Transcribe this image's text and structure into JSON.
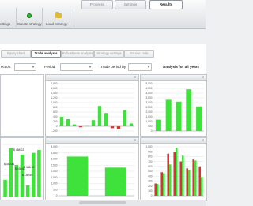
{
  "toolbar": {
    "settings_label": "ettings",
    "create_label": "Create strategy",
    "load_label": "Load strategy"
  },
  "main_tabs": [
    "Progress",
    "Settings",
    "Results"
  ],
  "sub_tabs": [
    "Equity chart",
    "Trade analysis",
    "Robustness analysis",
    "Strategy settings",
    "Source code"
  ],
  "filters": {
    "direction_label": "ection:",
    "period_label": "Period:",
    "trade_period_label": "Trade period by:",
    "analysis_label": "Analysis for all years"
  },
  "colors": {
    "green": "#3ee23a",
    "red": "#e0312d",
    "accent_button": "#2fb533"
  },
  "chart_data": [
    {
      "type": "bar",
      "position": "top-middle",
      "y_ticks": [
        "1,800",
        "1,600",
        "1,400",
        "1,200",
        "1,000",
        "800",
        "600",
        "400",
        "200",
        "0",
        "-200"
      ],
      "values": [
        400,
        300,
        80,
        -40,
        10,
        260,
        860,
        560,
        -80,
        -120,
        680,
        120
      ],
      "ylim": [
        -200,
        1800
      ]
    },
    {
      "type": "bar",
      "position": "top-right",
      "y_ticks": [
        "5,000",
        "4,500",
        "4,000",
        "3,500",
        "3,000",
        "2,500",
        "2,000",
        "1,500",
        "1,000",
        "500",
        "0"
      ],
      "values": [
        1200,
        3300,
        3100,
        4400,
        2600
      ],
      "ylim": [
        0,
        5000
      ]
    },
    {
      "type": "bar",
      "position": "bottom-left",
      "value_labels": [
        "$ 488.02",
        "$ 350.41",
        "$ 458.63",
        "$ 488.10",
        "$ 140.90"
      ],
      "series": [
        {
          "name": "",
          "values": [
            180,
            520,
            340,
            450,
            120,
            470,
            500
          ]
        }
      ]
    },
    {
      "type": "bar",
      "position": "bottom-middle",
      "y_ticks": [
        "4,000",
        "3,500",
        "3,000",
        "2,500",
        "2,000",
        "1,500",
        "1,000",
        "500",
        "0"
      ],
      "values": [
        3200,
        2300
      ],
      "ylim": [
        0,
        4000
      ]
    },
    {
      "type": "bar",
      "position": "bottom-right",
      "y_ticks": [
        "1,000",
        "900",
        "800",
        "700",
        "600",
        "500",
        "400",
        "300",
        "200",
        "100",
        "0"
      ],
      "series": [
        {
          "name": "",
          "color": "#e0312d",
          "values": [
            250,
            480,
            860,
            900,
            700,
            560,
            740,
            600
          ]
        },
        {
          "name": "",
          "color": "#3ee23a",
          "values": [
            240,
            460,
            640,
            980,
            820,
            520,
            720,
            380
          ]
        }
      ],
      "ylim": [
        0,
        1000
      ]
    }
  ]
}
